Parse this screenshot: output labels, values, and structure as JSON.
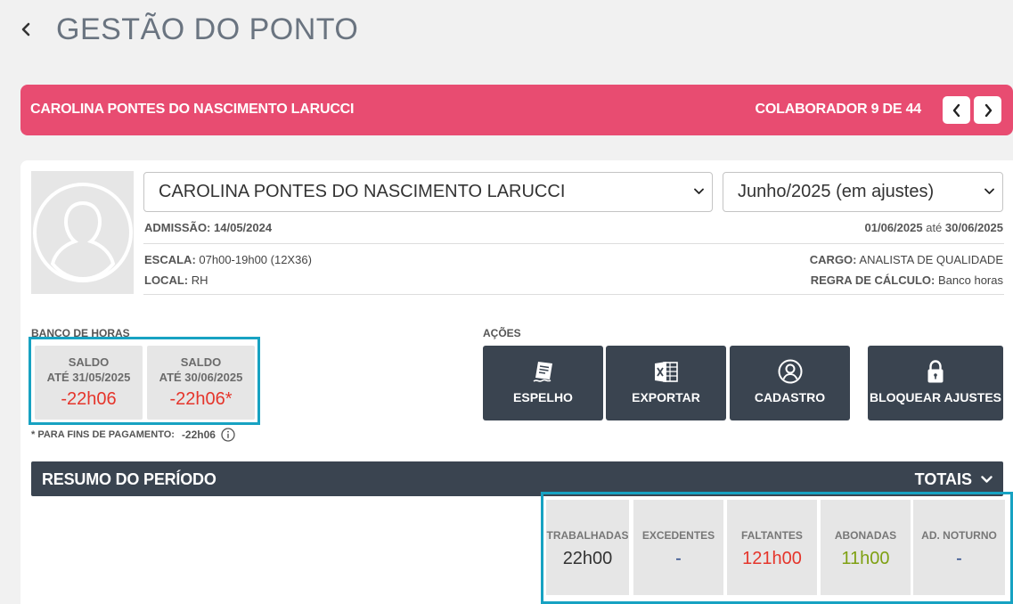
{
  "page": {
    "title": "GESTÃO DO PONTO"
  },
  "colaborador_bar": {
    "name": "CAROLINA PONTES DO NASCIMENTO LARUCCI",
    "count": "COLABORADOR 9 DE 44"
  },
  "profile": {
    "select_name": "CAROLINA PONTES DO NASCIMENTO LARUCCI",
    "select_period": "Junho/2025 (em ajustes)",
    "admissao_label": "ADMISSÃO:",
    "admissao_value": "14/05/2024",
    "range_start": "01/06/2025",
    "range_sep": "até",
    "range_end": "30/06/2025",
    "escala_label": "ESCALA:",
    "escala_value": "07h00-19h00 (12X36)",
    "local_label": "LOCAL:",
    "local_value": "RH",
    "cargo_label": "CARGO:",
    "cargo_value": "ANALISTA DE QUALIDADE",
    "regra_label": "REGRA DE CÁLCULO:",
    "regra_value": "Banco horas"
  },
  "banco_horas": {
    "label": "BANCO DE HORAS",
    "saldos": [
      {
        "line1": "SALDO",
        "line2": "ATÉ 31/05/2025",
        "value": "-22h06"
      },
      {
        "line1": "SALDO",
        "line2": "ATÉ 30/06/2025",
        "value": "-22h06*"
      }
    ],
    "pagamento_label": "* PARA FINS DE PAGAMENTO:",
    "pagamento_value": "-22h06"
  },
  "acoes": {
    "label": "AÇÕES",
    "buttons": [
      {
        "label": "ESPELHO",
        "icon": "document-signed-icon"
      },
      {
        "label": "EXPORTAR",
        "icon": "excel-icon"
      },
      {
        "label": "CADASTRO",
        "icon": "user-circle-icon"
      },
      {
        "label": "BLOQUEAR AJUSTES",
        "icon": "lock-icon"
      }
    ]
  },
  "resumo": {
    "title": "RESUMO DO PERÍODO",
    "totais_label": "TOTAIS",
    "totals": [
      {
        "label": "TRABALHADAS",
        "value": "22h00",
        "color": "#333333"
      },
      {
        "label": "EXCEDENTES",
        "value": "-",
        "color": "#2c4a8a"
      },
      {
        "label": "FALTANTES",
        "value": "121h00",
        "color": "#e5352b"
      },
      {
        "label": "ABONADAS",
        "value": "11h00",
        "color": "#7ea012"
      },
      {
        "label": "AD. NOTURNO",
        "value": "-",
        "color": "#2c4a8a"
      }
    ]
  },
  "colors": {
    "accent_pink": "#e84c71",
    "dark_bar": "#3a4450",
    "highlight_border": "#17a2c2",
    "negative": "#e5352b"
  }
}
